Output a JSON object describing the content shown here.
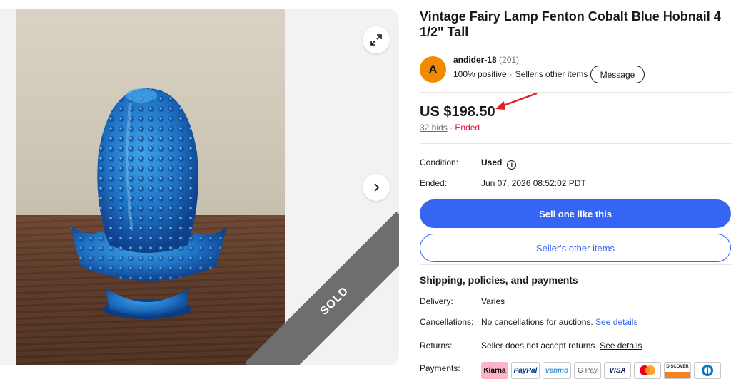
{
  "listing": {
    "title": "Vintage Fairy Lamp Fenton Cobalt Blue Hobnail 4 1/2\" Tall",
    "sold_label": "SOLD"
  },
  "seller": {
    "initial": "A",
    "name": "andider-18",
    "feedback_count": "(201)",
    "positive": "100% positive",
    "other_items": "Seller's other items",
    "message_label": "Message"
  },
  "price": {
    "amount": "US $198.50",
    "bids": "32 bids",
    "status": "Ended"
  },
  "details": {
    "condition_label": "Condition:",
    "condition_value": "Used",
    "ended_label": "Ended:",
    "ended_value": "Jun 07, 2026 08:52:02 PDT"
  },
  "actions": {
    "sell_one": "Sell one like this",
    "sellers_other": "Seller's other items"
  },
  "shipping": {
    "title": "Shipping, policies, and payments",
    "delivery_label": "Delivery:",
    "delivery_value": "Varies",
    "cancel_label": "Cancellations:",
    "cancel_value": "No cancellations for auctions.",
    "cancel_link": "See details",
    "returns_label": "Returns:",
    "returns_value": "Seller does not accept returns.",
    "returns_link": "See details",
    "payments_label": "Payments:",
    "payment_methods": [
      "Klarna",
      "PayPal",
      "venmo",
      "G Pay",
      "VISA",
      "Mastercard",
      "DISCOVER",
      "Diners"
    ]
  },
  "colors": {
    "accent": "#3665f3",
    "ended": "#e0103a",
    "avatar": "#f18a00"
  }
}
